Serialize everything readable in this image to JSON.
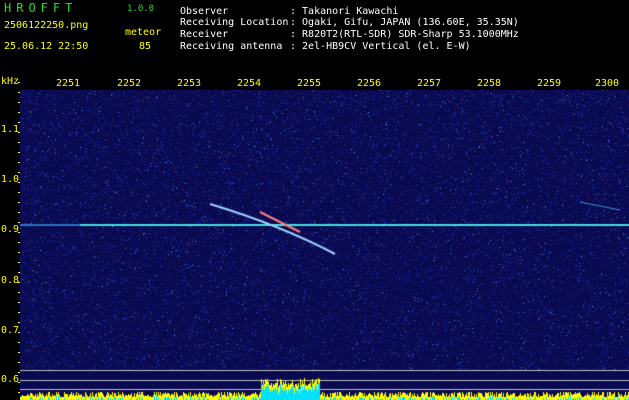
{
  "header": {
    "logo": "HROFFT",
    "version": "1.0.0",
    "filename": "2506122250.png",
    "timestamp": "25.06.12 22:50",
    "mode": "meteor",
    "count": "85"
  },
  "station": {
    "observer_label": "Observer",
    "observer_value": ": Takanori Kawachi",
    "location_label": "Receiving Location",
    "location_value": ": Ogaki, Gifu, JAPAN (136.60E, 35.35N)",
    "receiver_label": "Receiver",
    "receiver_value": ": R820T2(RTL-SDR) SDR-Sharp 53.1000MHz",
    "antenna_label": "Receiving antenna",
    "antenna_value": ": 2el-HB9CV Vertical (el. E-W)"
  },
  "axes": {
    "y_unit": "kHz",
    "x_ticks": [
      "2251",
      "2252",
      "2253",
      "2254",
      "2255",
      "2256",
      "2257",
      "2258",
      "2259",
      "2300"
    ],
    "y_ticks": [
      "1.1",
      "1.0",
      "0.9",
      "0.8",
      "0.7",
      "0.6"
    ]
  },
  "colors": {
    "background": "#0a0a50",
    "noise": "#1e2a9a",
    "carrier": "#3fe0e0",
    "meteor": "#ff8080",
    "level": "#ffff00",
    "axis_text": "#ffff00"
  }
}
